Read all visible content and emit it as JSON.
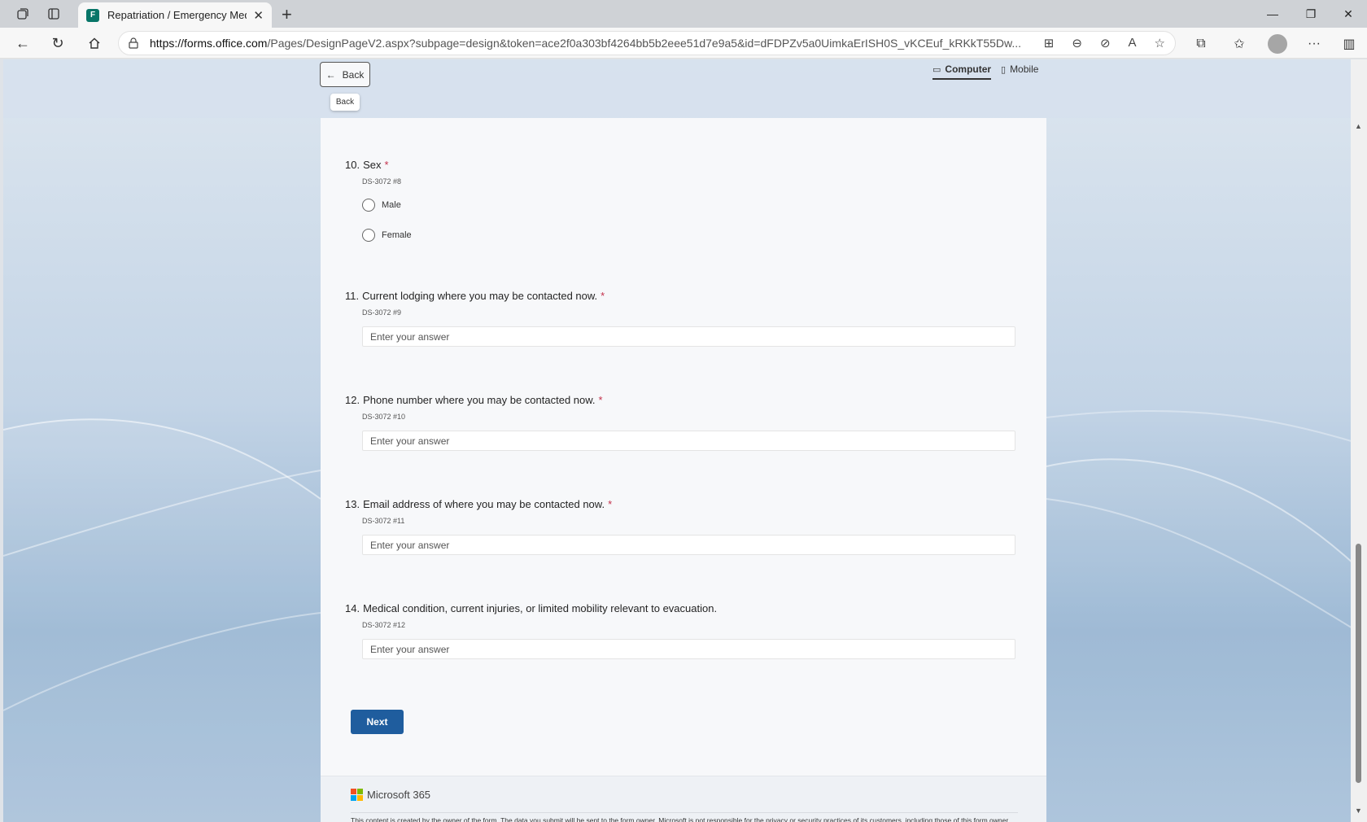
{
  "browser": {
    "tab_title": "Repatriation / Emergency Medical",
    "tab_favicon": "F",
    "url_host": "https://forms.office.com",
    "url_path": "/Pages/DesignPageV2.aspx?subpage=design&token=ace2f0a303bf4264bb5b2eee51d7e9a5&id=dFDPZv5a0UimkaErISH0S_vKCEuf_kRKkT55Dw..."
  },
  "header": {
    "back_label": "Back",
    "back_tooltip": "Back",
    "view_computer": "Computer",
    "view_mobile": "Mobile"
  },
  "questions": [
    {
      "number": "10.",
      "title": "Sex",
      "required": "*",
      "subtitle": "DS-3072 #8",
      "options": [
        "Male",
        "Female"
      ]
    },
    {
      "number": "11.",
      "title": "Current lodging where you may be contacted now.",
      "required": "*",
      "subtitle": "DS-3072 #9",
      "placeholder": "Enter your answer"
    },
    {
      "number": "12.",
      "title": "Phone number where you may be contacted now.",
      "required": "*",
      "subtitle": "DS-3072 #10",
      "placeholder": "Enter your answer"
    },
    {
      "number": "13.",
      "title": "Email address of where you may be contacted now.",
      "required": "*",
      "subtitle": "DS-3072 #11",
      "placeholder": "Enter your answer"
    },
    {
      "number": "14.",
      "title": "Medical condition, current injuries, or limited mobility relevant to evacuation.",
      "subtitle": "DS-3072 #12",
      "placeholder": "Enter your answer"
    }
  ],
  "next_label": "Next",
  "footer": {
    "brand": "Microsoft 365",
    "disclaimer": "This content is created by the owner of the form. The data you submit will be sent to the form owner. Microsoft is not responsible for the privacy or security practices of its customers, including those of this form owner. Never give out your password."
  },
  "colors": {
    "accent": "#1f5d9e",
    "required": "#c4314b",
    "ms_red": "#f25022",
    "ms_green": "#7fba00",
    "ms_blue": "#00a4ef",
    "ms_yellow": "#ffb900"
  }
}
